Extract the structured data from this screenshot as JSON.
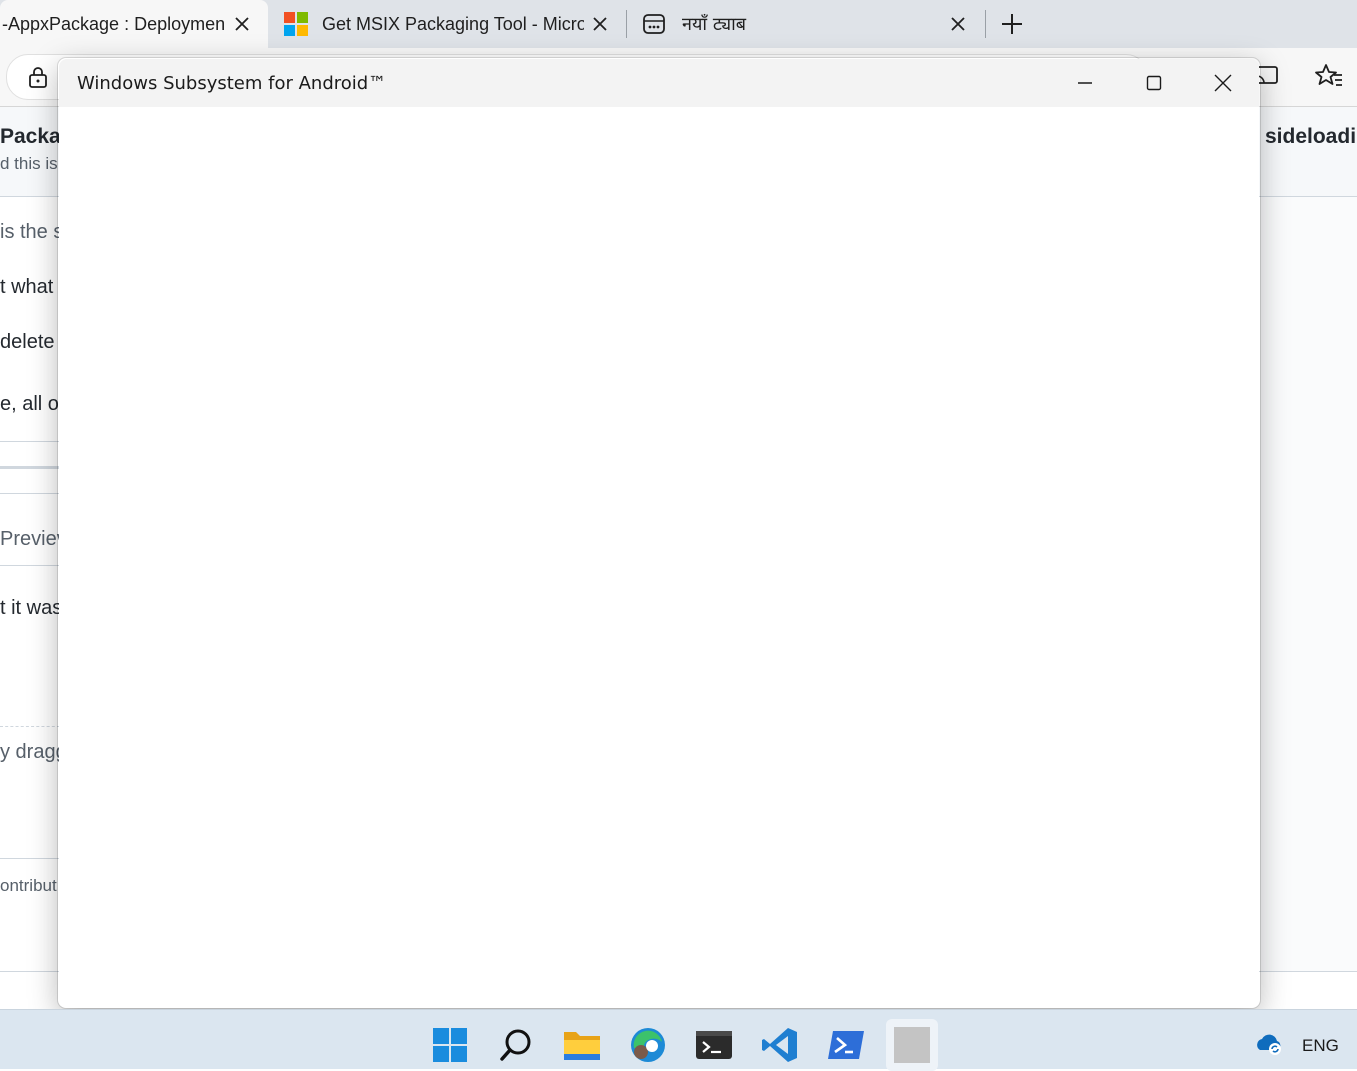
{
  "browser": {
    "tabs": [
      {
        "title": "-AppxPackage : Deployment",
        "icon": "document-icon"
      },
      {
        "title": "Get MSIX Packaging Tool - Micro",
        "icon": "microsoft-logo-icon"
      },
      {
        "title": "नयाँ ट्याब",
        "icon": "new-tab-page-icon"
      }
    ]
  },
  "page": {
    "heading_left": "Packag",
    "subtext": "d this is",
    "heading_right": "sideloadir",
    "lines": [
      "is the s",
      "t what",
      "delete",
      "e, all of",
      "Previev",
      "t it was",
      "y dragg",
      "ontribut"
    ]
  },
  "wsa": {
    "title": "Windows Subsystem for Android™"
  },
  "taskbar": {
    "apps": [
      "start-icon",
      "search-icon",
      "file-explorer-icon",
      "edge-icon",
      "terminal-icon",
      "vscode-icon",
      "powershell-icon",
      "wsa-app-icon"
    ],
    "tray_language": "ENG",
    "colors": {
      "accent": "#0078d4"
    }
  }
}
